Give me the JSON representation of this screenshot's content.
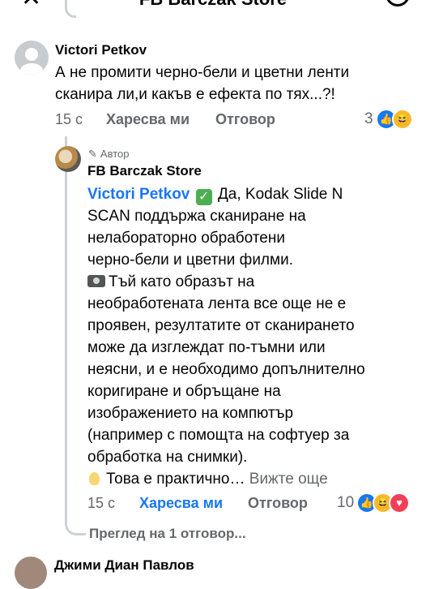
{
  "header": {
    "title": "FB Barczak Store"
  },
  "comment1": {
    "author": "Victori Petkov",
    "text_line1": "А не промити черно-бели и цветни ленти",
    "text_line2": "сканира ли,и какъв е ефекта по тях...?!",
    "time": "15 с",
    "like_label": "Харесва ми",
    "reply_label": "Отговор",
    "reaction_count": "3"
  },
  "reply": {
    "author_badge": "Автор",
    "author": "FB Barczak Store",
    "mention": "Victori Petkov",
    "line1_rest": "Да, Kodak Slide N",
    "lines": [
      "SCAN поддържа сканиране на",
      "нелабораторно обработени",
      "черно-бели и цветни филми."
    ],
    "para2_first": "Тъй като образът на",
    "para2_lines": [
      "необработената лента все още не е",
      "проявен, резултатите от сканирането",
      "може да изглеждат по-тъмни или",
      "неясни, и е необходимо допълнително",
      "коригиране и обръщане на",
      "изображението на компютър",
      "(например с помощта на софтуер за",
      "обработка на снимки)."
    ],
    "last_line": "Това е практично…",
    "see_more": "Вижте още",
    "time": "15 с",
    "like_label": "Харесва ми",
    "reply_label": "Отговор",
    "reaction_count": "10"
  },
  "view_replies": "Преглед на 1 отговор...",
  "next_comment": {
    "author": "Джими Диан Павлов"
  },
  "colors": {
    "accent": "#1877f2",
    "meta": "#65676b",
    "check": "#4caf50"
  }
}
